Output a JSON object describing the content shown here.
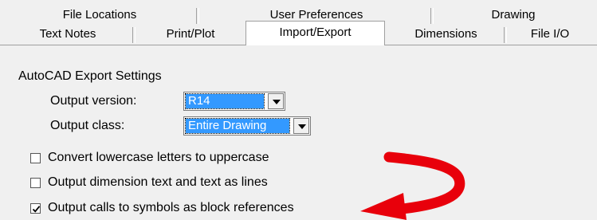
{
  "tabs": {
    "back_row": [
      {
        "label": "File Locations"
      },
      {
        "label": "User Preferences"
      },
      {
        "label": "Drawing"
      }
    ],
    "front_row": [
      {
        "label": "Text Notes"
      },
      {
        "label": "Print/Plot"
      },
      {
        "label": "Import/Export",
        "active": true
      },
      {
        "label": "Dimensions"
      },
      {
        "label": "File I/O"
      }
    ]
  },
  "panel": {
    "section_title": "AutoCAD Export Settings",
    "output_version": {
      "label": "Output version:",
      "value": "R14"
    },
    "output_class": {
      "label": "Output class:",
      "value": "Entire Drawing"
    },
    "checkboxes": [
      {
        "label": "Convert lowercase letters to uppercase",
        "checked": false
      },
      {
        "label": "Output dimension text and text as lines",
        "checked": false
      },
      {
        "label": "Output calls to symbols as block references",
        "checked": true
      }
    ]
  },
  "annotation": {
    "color": "#e8000b",
    "icon": "curved-arrow-icon"
  }
}
